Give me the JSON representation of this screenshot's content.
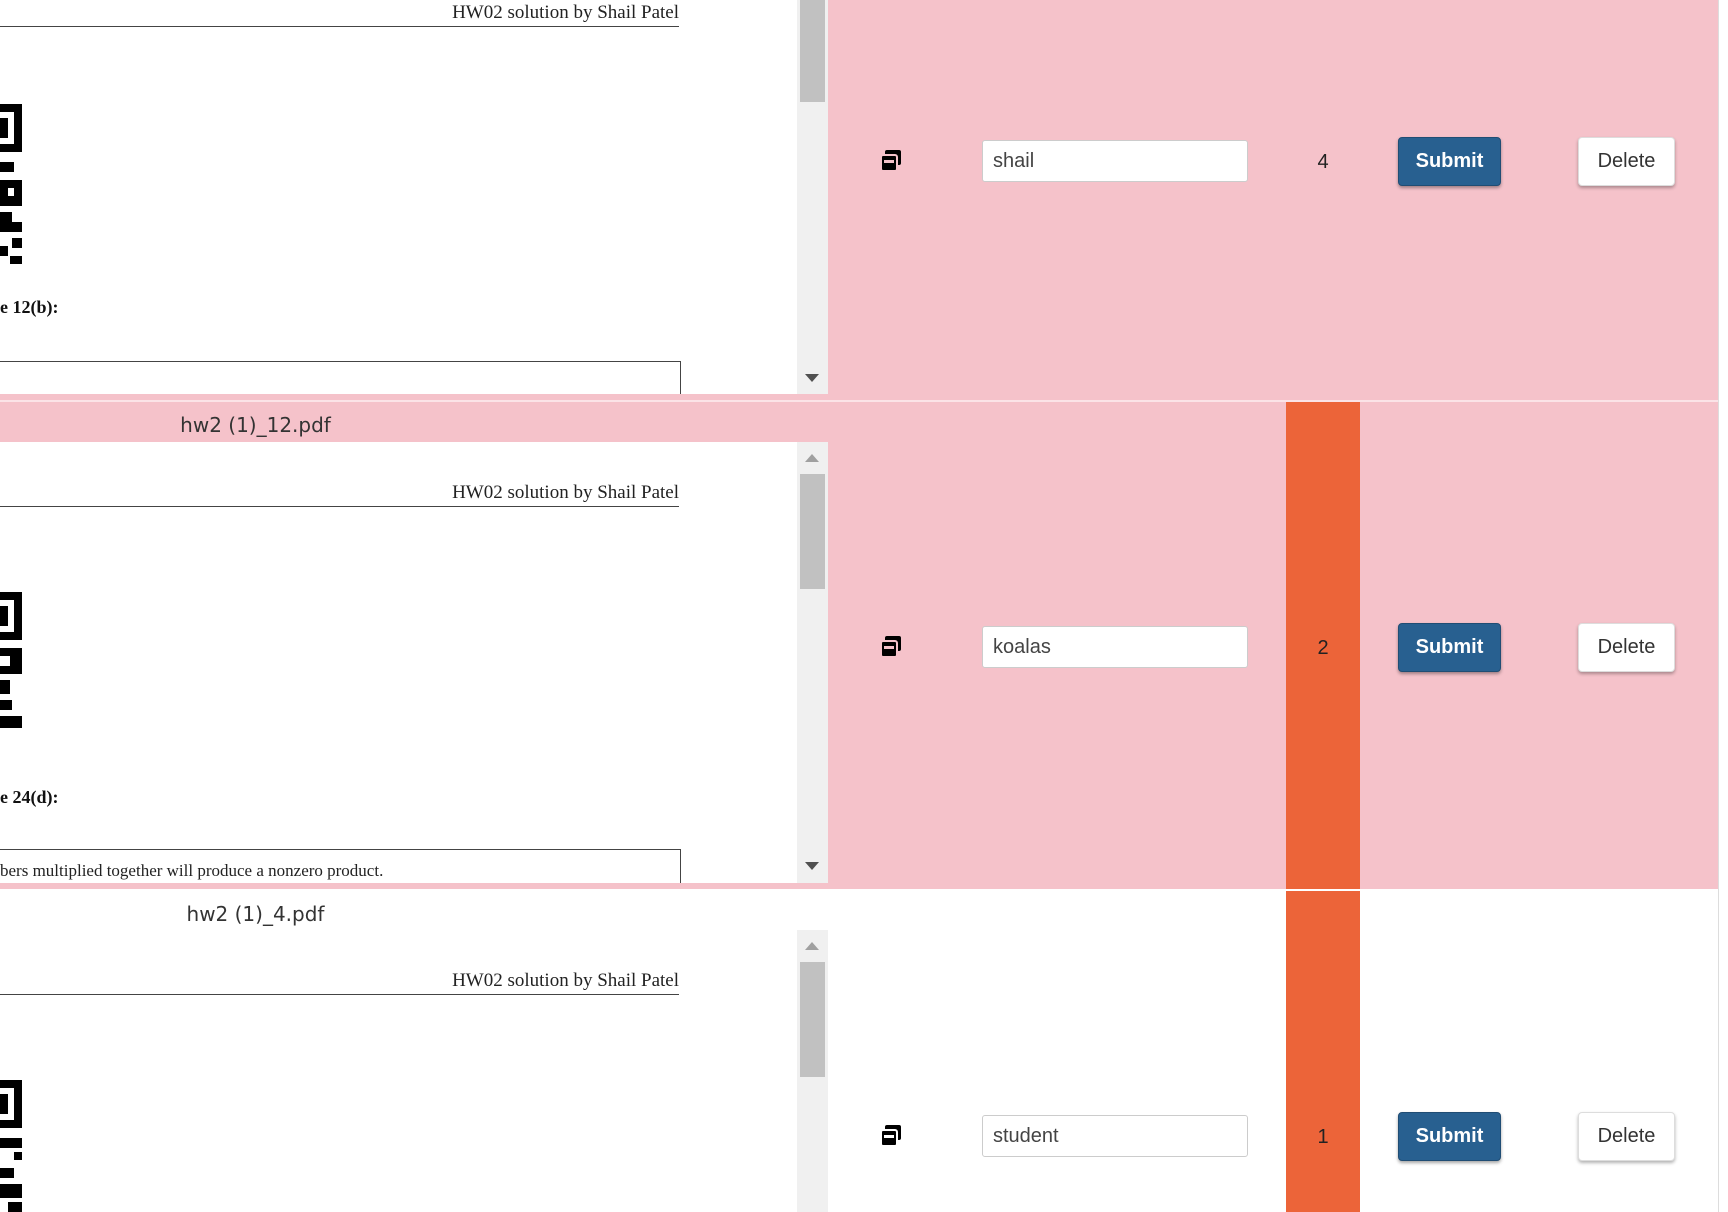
{
  "rows": [
    {
      "filename": "",
      "doc_header": "HW02 solution by Shail Patel",
      "question": "e 12(b):",
      "answer": "",
      "name_value": "shail",
      "count": "4",
      "count_color": "#f5c2ca",
      "submit_label": "Submit",
      "delete_label": "Delete"
    },
    {
      "filename": "hw2 (1)_12.pdf",
      "doc_header": "HW02 solution by Shail Patel",
      "question": "e 24(d):",
      "answer": "bers multiplied together will produce a nonzero product.",
      "name_value": "koalas",
      "count": "2",
      "count_color": "#ec6439",
      "submit_label": "Submit",
      "delete_label": "Delete"
    },
    {
      "filename": "hw2 (1)_4.pdf",
      "doc_header": "HW02 solution by Shail Patel",
      "question": "",
      "answer": "",
      "name_value": "student",
      "count": "1",
      "count_color": "#ec6439",
      "submit_label": "Submit",
      "delete_label": "Delete"
    }
  ],
  "icons": {
    "copy": "copy-icon"
  },
  "colors": {
    "row_flagged": "#f5c2ca",
    "count_highlight": "#ec6439",
    "submit_button": "#286090"
  }
}
